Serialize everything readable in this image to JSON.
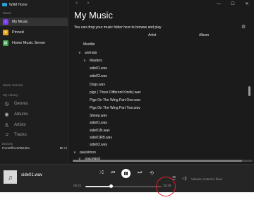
{
  "window": {
    "app_title": "WiiM Home",
    "controls": {
      "minimize": "—",
      "maximize": "☐",
      "close": "✕"
    },
    "nav": {
      "back": "<",
      "forward": ">"
    }
  },
  "sidebar": {
    "section_label": "Music",
    "sources": [
      {
        "label": "My Music",
        "icon": "music-note-icon",
        "color": "#7b3fe4",
        "glyph": "♪"
      },
      {
        "label": "Pinned",
        "icon": "pin-icon",
        "color": "#e8a31b",
        "glyph": "★"
      },
      {
        "label": "Home Music Server",
        "icon": "server-icon",
        "color": "#3aa64a",
        "glyph": "▤"
      }
    ],
    "music_service_label": "Music Service",
    "my_library_label": "My Library",
    "library": [
      {
        "label": "Genres",
        "icon": "genres-icon",
        "glyph": "◷"
      },
      {
        "label": "Albums",
        "icon": "album-icon",
        "glyph": "◉"
      },
      {
        "label": "Artists",
        "icon": "artist-icon",
        "glyph": "♙"
      },
      {
        "label": "Tracks",
        "icon": "track-icon",
        "glyph": "♫"
      }
    ],
    "devices_label": "Devices",
    "device_name": "FrontOfficeWiiMUltra",
    "device_side": "Bk  U/"
  },
  "main": {
    "title": "My Music",
    "subtitle": "You can drop your music folder here to browse and play",
    "columns": {
      "artist": "Artist",
      "album": "Album"
    },
    "tree": [
      {
        "label": "Meddle",
        "chevron": ""
      },
      {
        "label": "animals",
        "chevron": "∨"
      },
      {
        "label": "Masters",
        "chevron": "∨"
      },
      {
        "label": "side01.wav",
        "chevron": ""
      },
      {
        "label": "side02.wav",
        "chevron": ""
      },
      {
        "label": "Dogs.wav",
        "chevron": ""
      },
      {
        "label": "pigs ( Three Different Kinds).wav",
        "chevron": ""
      },
      {
        "label": "Pigs On The Wing Part One.wav",
        "chevron": ""
      },
      {
        "label": "Pigs On The Wing Part Two.wav",
        "chevron": ""
      },
      {
        "label": "Sheep.wav",
        "chevron": ""
      },
      {
        "label": "side01.wav",
        "chevron": ""
      },
      {
        "label": "side01N.wav",
        "chevron": ""
      },
      {
        "label": "side01RB.wav",
        "chevron": ""
      },
      {
        "label": "side02.wav",
        "chevron": ""
      },
      {
        "label": "paulsimon",
        "chevron": "∨"
      },
      {
        "label": "graceland",
        "chevron": "∨"
      }
    ]
  },
  "player": {
    "now_playing": "side01.wav",
    "elapsed": "06:21",
    "duration": "18:26",
    "progress_fraction": 0.34,
    "volume_text": "Volume control is fixed",
    "icons": {
      "shuffle": "⤮",
      "prev": "⏮",
      "next": "⏭",
      "repeat": "⟲",
      "queue": "☰",
      "volume": "◁)"
    }
  },
  "annotation_color": "#e0202b"
}
